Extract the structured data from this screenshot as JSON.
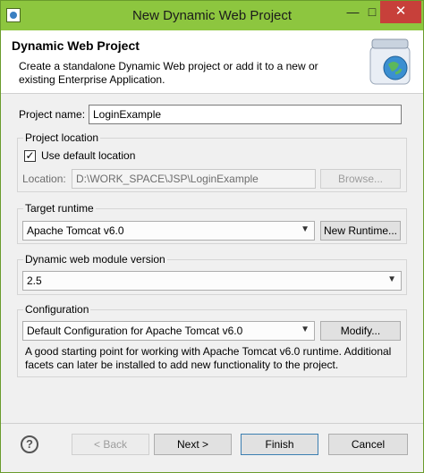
{
  "window": {
    "title": "New Dynamic Web Project",
    "controls": {
      "minimize": "—",
      "maximize": "□",
      "close": "✕"
    }
  },
  "header": {
    "title": "Dynamic Web Project",
    "description": "Create a standalone Dynamic Web project or add it to a new or existing Enterprise Application."
  },
  "project_name": {
    "label": "Project name:",
    "value": "LoginExample"
  },
  "project_location": {
    "group_label": "Project location",
    "use_default_label": "Use default location",
    "use_default_checked": "✓",
    "location_label": "Location:",
    "location_value": "D:\\WORK_SPACE\\JSP\\LoginExample",
    "browse_label": "Browse..."
  },
  "target_runtime": {
    "group_label": "Target runtime",
    "selected": "Apache Tomcat v6.0",
    "new_runtime_label": "New Runtime..."
  },
  "module_version": {
    "group_label": "Dynamic web module version",
    "selected": "2.5"
  },
  "configuration": {
    "group_label": "Configuration",
    "selected": "Default Configuration for Apache Tomcat v6.0",
    "modify_label": "Modify...",
    "description": "A good starting point for working with Apache Tomcat v6.0 runtime. Additional facets can later be installed to add new functionality to the project."
  },
  "footer": {
    "help": "?",
    "back_label": "< Back",
    "next_label": "Next >",
    "finish_label": "Finish",
    "cancel_label": "Cancel"
  },
  "icons": {
    "dropdown_arrow": "▼"
  },
  "colors": {
    "titlebar": "#8dc63f",
    "close_button": "#c7403a"
  }
}
